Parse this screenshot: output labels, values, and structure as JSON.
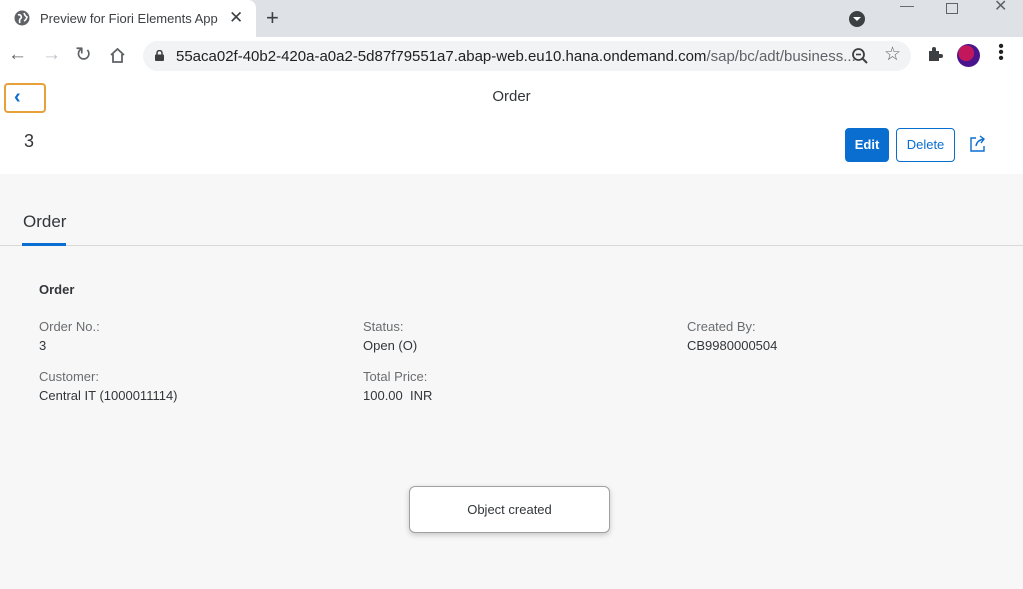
{
  "browser": {
    "tab_title": "Preview for Fiori Elements App",
    "tab_close": "✕",
    "new_tab": "+",
    "url_host": "55aca02f-40b2-420a-a0a2-5d87f79551a7.abap-web.eu10.hana.ondemand.com",
    "url_path": "/sap/bc/adt/business...",
    "icons": [
      "globe-icon",
      "back-arrow-icon",
      "forward-arrow-icon",
      "reload-icon",
      "home-icon",
      "lock-icon",
      "zoom-icon",
      "star-icon",
      "extensions-icon",
      "avatar",
      "menu-icon"
    ]
  },
  "app": {
    "title": "Order",
    "back_icon": "‹"
  },
  "object": {
    "title": "3",
    "edit_label": "Edit",
    "delete_label": "Delete"
  },
  "anchor": {
    "tab_label": "Order"
  },
  "section": {
    "title": "Order",
    "fields": {
      "order_no_label": "Order No.:",
      "order_no_value": "3",
      "status_label": "Status:",
      "status_value": "Open (O)",
      "created_by_label": "Created By:",
      "created_by_value": "CB9980000504",
      "customer_label": "Customer:",
      "customer_value": "Central IT (1000011114)",
      "total_price_label": "Total Price:",
      "total_price_value": "100.00  INR"
    }
  },
  "toast": {
    "message": "Object created"
  },
  "colors": {
    "accent": "#0a6ed1",
    "focus_outline": "#e8a13a"
  }
}
